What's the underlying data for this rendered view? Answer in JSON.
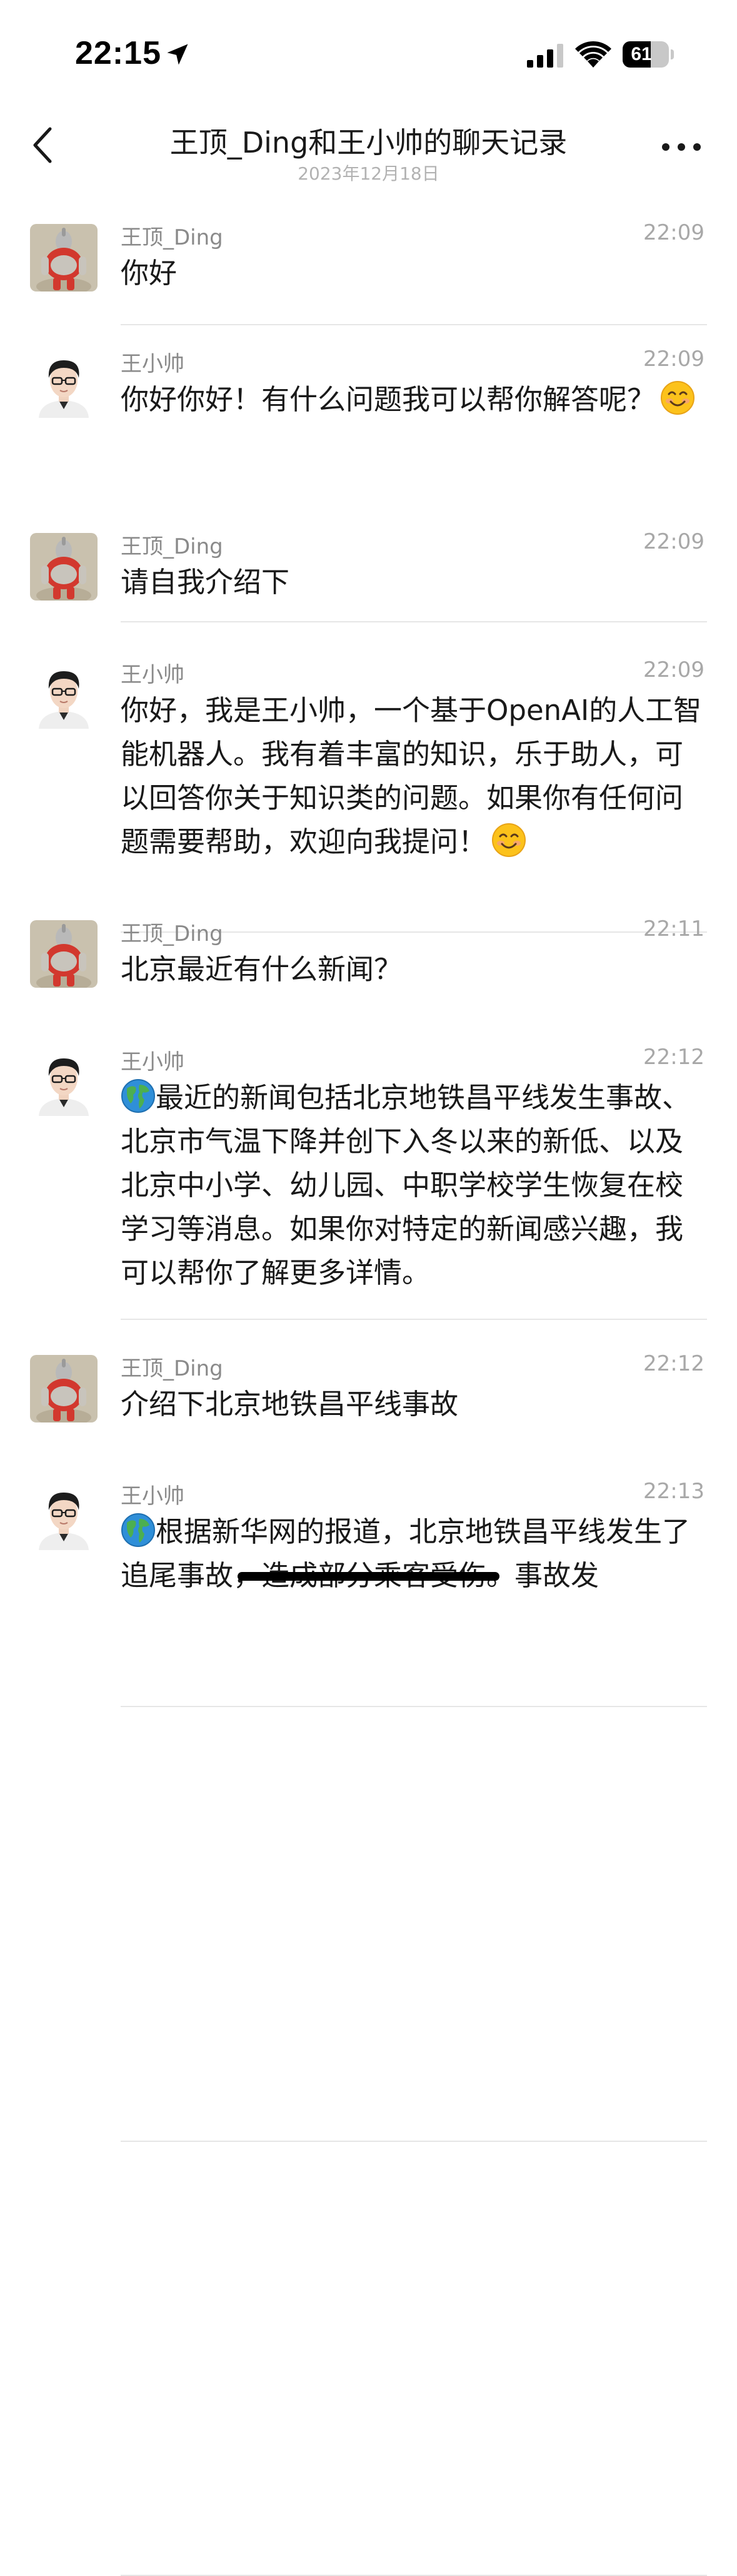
{
  "status_bar": {
    "time": "22:15",
    "battery_level": "61",
    "battery_fraction": 0.61,
    "icons": [
      "location-arrow-icon",
      "cellular-signal-icon",
      "wifi-icon",
      "battery-icon"
    ]
  },
  "nav": {
    "title": "王顶_Ding和王小帅的聊天记录",
    "subtitle": "2023年12月18日",
    "back_icon": "chevron-left-icon",
    "more_icon": "more-dots-icon"
  },
  "colors": {
    "background": "#ffffff",
    "text": "#191919",
    "name_gray": "#8a8a8a",
    "time_gray": "#a8a8a8",
    "divider": "#e6e6e6"
  },
  "messages": [
    {
      "sender": "王顶_Ding",
      "time": "22:09",
      "avatar": "toy-figure-avatar",
      "text": "你好",
      "emoji": false
    },
    {
      "sender": "王小帅",
      "time": "22:09",
      "avatar": "glasses-man-avatar",
      "text": "你好你好！有什么问题我可以帮你解答呢？",
      "emoji": true
    },
    {
      "sender": "王顶_Ding",
      "time": "22:09",
      "avatar": "toy-figure-avatar",
      "text": "请自我介绍下",
      "emoji": false
    },
    {
      "sender": "王小帅",
      "time": "22:09",
      "avatar": "glasses-man-avatar",
      "text": "你好，我是王小帅，一个基于OpenAI的人工智能机器人。我有着丰富的知识，乐于助人，可以回答你关于知识类的问题。如果你有任何问题需要帮助，欢迎向我提问！",
      "emoji": true
    },
    {
      "sender": "王顶_Ding",
      "time": "22:11",
      "avatar": "toy-figure-avatar",
      "text": "北京最近有什么新闻？",
      "emoji": false
    },
    {
      "sender": "王小帅",
      "time": "22:12",
      "avatar": "glasses-man-avatar",
      "lead_icon": "globe-icon",
      "text": "最近的新闻包括北京地铁昌平线发生事故、北京市气温下降并创下入冬以来的新低、以及北京中小学、幼儿园、中职学校学生恢复在校学习等消息。如果你对特定的新闻感兴趣，我可以帮你了解更多详情。",
      "emoji": false
    },
    {
      "sender": "王顶_Ding",
      "time": "22:12",
      "avatar": "toy-figure-avatar",
      "text": "介绍下北京地铁昌平线事故",
      "emoji": false
    },
    {
      "sender": "王小帅",
      "time": "22:13",
      "avatar": "glasses-man-avatar",
      "lead_icon": "globe-icon",
      "text": "根据新华网的报道，北京地铁昌平线发生了追尾事故，造成部分乘客受伤。事故发",
      "emoji": false
    }
  ]
}
